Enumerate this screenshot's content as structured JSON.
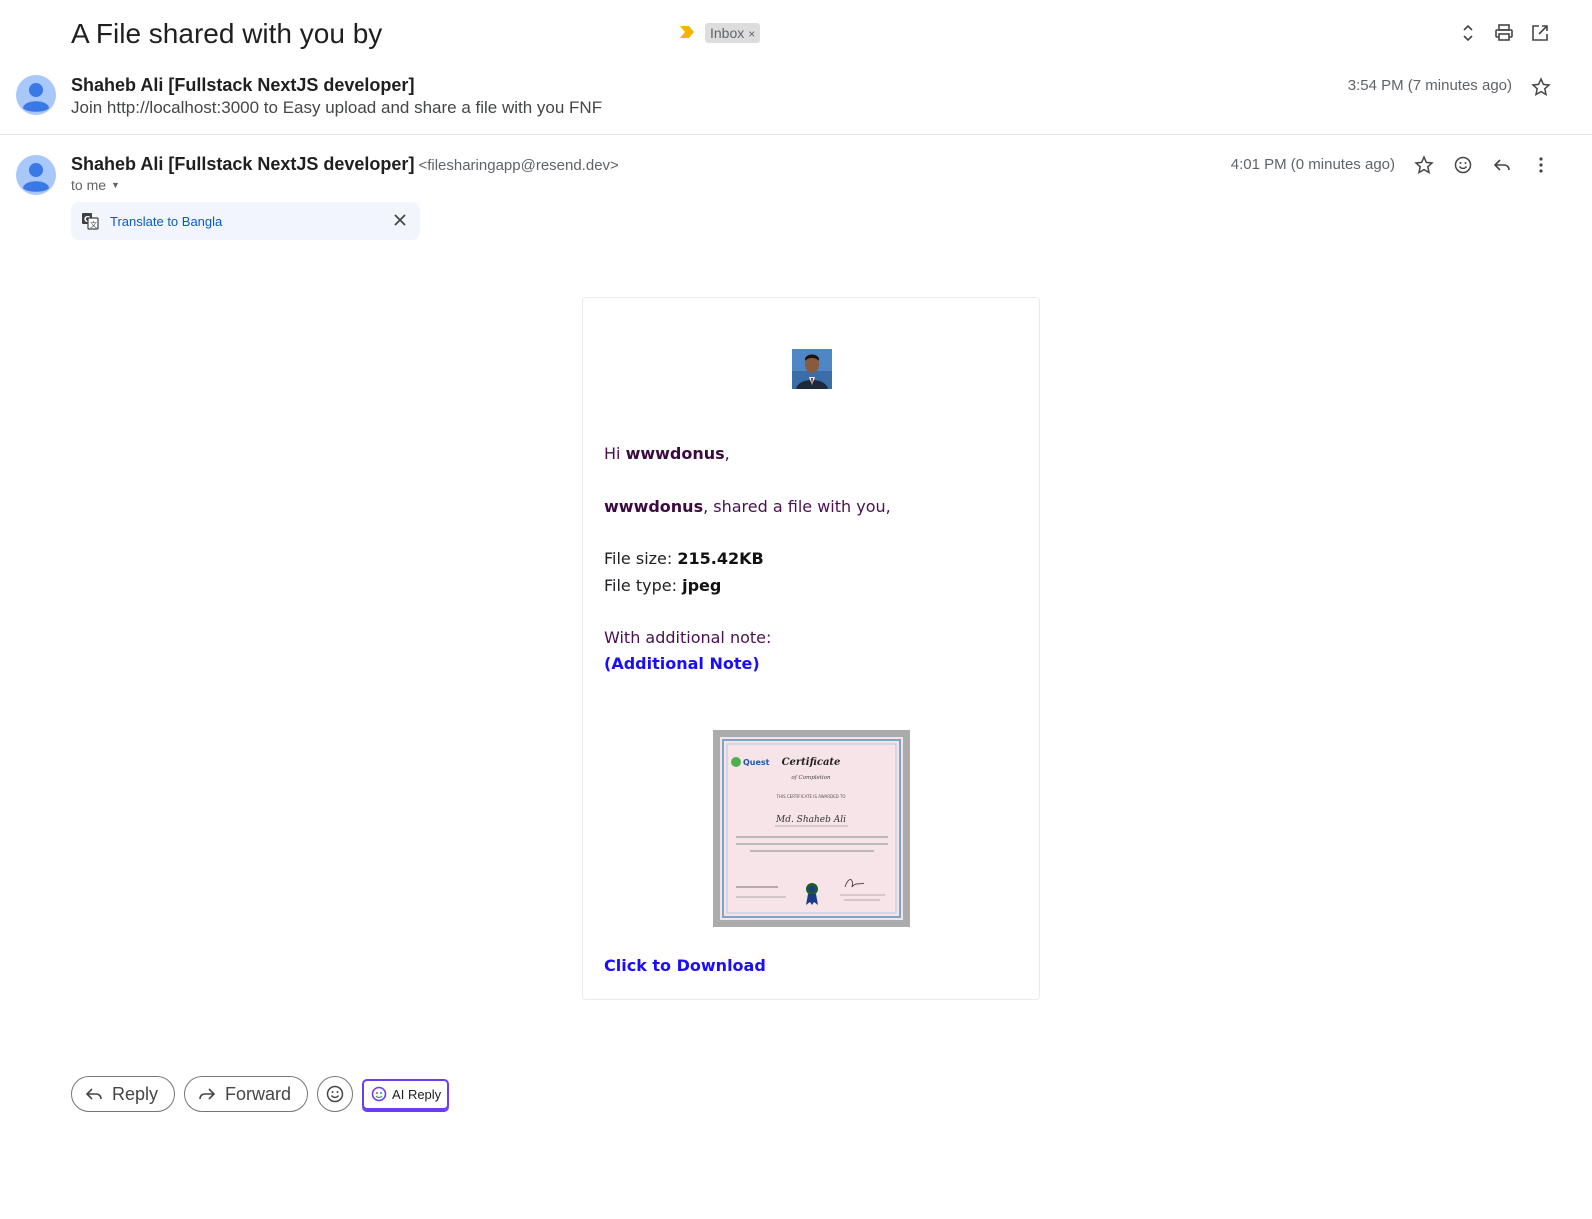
{
  "thread": {
    "subject": "A File shared with you by",
    "label_chip": "Inbox",
    "label_remove": "×"
  },
  "messages": [
    {
      "sender": "Shaheb Ali [Fullstack NextJS developer]",
      "snippet": "Join http://localhost:3000 to Easy upload and share a file with you FNF",
      "time": "3:54 PM (7 minutes ago)"
    },
    {
      "sender": "Shaheb Ali [Fullstack NextJS developer]",
      "email": "<filesharingapp@resend.dev>",
      "recipient": "to me",
      "time": "4:01 PM (0 minutes ago)"
    }
  ],
  "translate": {
    "label": "Translate to Bangla"
  },
  "email_body": {
    "greeting_prefix": "Hi ",
    "username": "wwwdonus",
    "greeting_suffix": ",",
    "shared_user": "wwwdonus",
    "shared_text": ", shared a file with you,",
    "file_size_label": "File size: ",
    "file_size": "215.42KB",
    "file_type_label": "File type: ",
    "file_type": "jpeg",
    "note_label": "With additional note:",
    "note_value": "(Additional Note)",
    "download_label": "Click to Download"
  },
  "certificate": {
    "brand": "Quest",
    "title": "Certificate",
    "subtitle": "of Completion",
    "awarded_line": "THIS CERTIFICATE IS AWARDED TO",
    "recipient": "Md. Shaheb Ali"
  },
  "actions": {
    "reply": "Reply",
    "forward": "Forward",
    "ai_reply": "AI Reply"
  },
  "colors": {
    "link": "#1a0dff",
    "avatar": "#a8c7fa",
    "translate_link": "#0b57d0",
    "ai_border": "#6b3cf6"
  }
}
